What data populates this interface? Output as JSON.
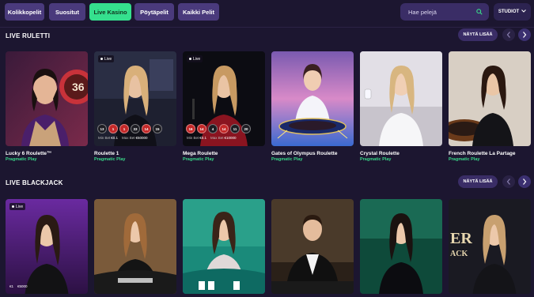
{
  "nav": {
    "tabs": [
      {
        "label": "Kolikkopelit",
        "active": false
      },
      {
        "label": "Suositut",
        "active": false
      },
      {
        "label": "Live Kasino",
        "active": true
      },
      {
        "label": "Pöytäpelit",
        "active": false
      },
      {
        "label": "Kaikki Pelit",
        "active": false
      }
    ],
    "search_placeholder": "Hae pelejä",
    "studio_label": "STUDIOT"
  },
  "sections": [
    {
      "title": "LIVE RULETTI",
      "more_label": "NÄYTÄ LISÄÄ",
      "games": [
        {
          "name": "Lucky 6 Roulette™",
          "provider": "Pragmatic Play"
        },
        {
          "name": "Roulette 1",
          "provider": "Pragmatic Play",
          "live": "Live",
          "results": [
            "13",
            "1",
            "1",
            "33",
            "14",
            "15"
          ],
          "min_label": "Min Bet",
          "min_bet": "€0.1",
          "max_label": "Max Bet",
          "max_bet": "€50000"
        },
        {
          "name": "Mega Roulette",
          "provider": "Pragmatic Play",
          "live": "Live",
          "results": [
            "16",
            "14",
            "4",
            "14",
            "11",
            "20"
          ],
          "min_label": "Min Bet",
          "min_bet": "€0.1",
          "max_label": "Max Bet",
          "max_bet": "€10000"
        },
        {
          "name": "Gates of Olympus Roulette",
          "provider": "Pragmatic Play"
        },
        {
          "name": "Crystal Roulette",
          "provider": "Pragmatic Play"
        },
        {
          "name": "French Roulette La Partage",
          "provider": "Pragmatic Play"
        }
      ]
    },
    {
      "title": "LIVE BLACKJACK",
      "more_label": "NÄYTÄ LISÄÄ",
      "games": [
        {
          "name": "",
          "provider": "",
          "live": "Live",
          "min_bet": "€1",
          "max_bet": "€5000"
        },
        {
          "name": "",
          "provider": ""
        },
        {
          "name": "",
          "provider": ""
        },
        {
          "name": "",
          "provider": ""
        },
        {
          "name": "",
          "provider": ""
        },
        {
          "name": "",
          "provider": ""
        }
      ]
    }
  ],
  "colors": {
    "background": "#1c1630",
    "tab": "#4a3a7c",
    "tab_active": "#35e08e",
    "provider": "#39d98a",
    "red_number": "#c42828",
    "black_number": "#1c1c22"
  },
  "icons": {
    "search": "search-icon",
    "studio": "chevron-down-icon",
    "prev": "chevron-left-icon",
    "next": "chevron-right-icon",
    "live": "live-dot-icon"
  }
}
